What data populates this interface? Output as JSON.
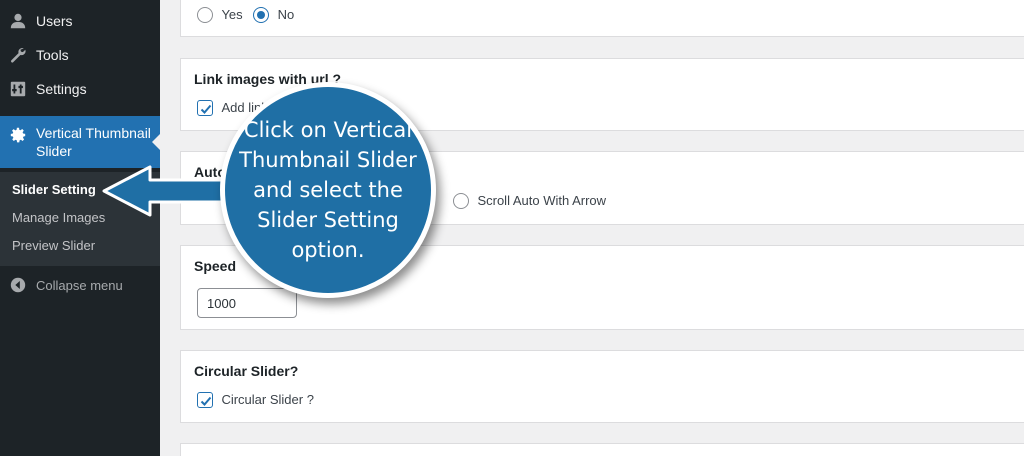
{
  "sidebar": {
    "items": [
      {
        "label": "Users",
        "icon": "user-icon"
      },
      {
        "label": "Tools",
        "icon": "wrench-icon"
      },
      {
        "label": "Settings",
        "icon": "settings-sliders-icon"
      }
    ],
    "active": {
      "label_line1": "Vertical Thumbnail",
      "label_line2": "Slider",
      "icon": "gear-icon"
    },
    "submenu": [
      "Slider Setting",
      "Manage Images",
      "Preview Slider"
    ],
    "collapse_label": "Collapse menu"
  },
  "panels": {
    "top": {
      "yes_label": "Yes",
      "no_label": "No",
      "selected": "No"
    },
    "link": {
      "title": "Link images with url ?",
      "checkbox_label": "Add link",
      "checked": true
    },
    "auto": {
      "title": "Auto",
      "scroll_label": "Scroll Auto With Arrow"
    },
    "speed": {
      "title": "Speed",
      "value": "1000"
    },
    "circular": {
      "title": "Circular Slider?",
      "checkbox_label": "Circular Slider ?",
      "checked": true
    }
  },
  "callout": {
    "text": "Click on Vertical Thumbnail Slider and select the Slider Setting option."
  },
  "colors": {
    "sidebar_bg": "#1d2327",
    "accent": "#2271b1",
    "bubble": "#1f6fa5"
  }
}
